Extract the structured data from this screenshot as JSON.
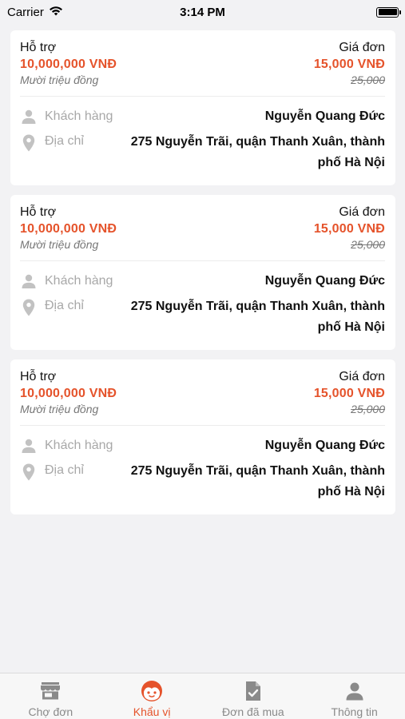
{
  "status_bar": {
    "carrier": "Carrier",
    "time": "3:14 PM"
  },
  "orders": [
    {
      "support_label": "Hỗ trợ",
      "support_amount": "10,000,000 VNĐ",
      "support_words": "Mười triệu đồng",
      "price_label": "Giá đơn",
      "price_amount": "15,000 VNĐ",
      "price_old": "25,000",
      "customer_label": "Khách hàng",
      "customer_name": "Nguyễn Quang Đức",
      "address_label": "Địa chỉ",
      "address_value": "275 Nguyễn Trãi, quận Thanh Xuân, thành phố Hà Nội"
    },
    {
      "support_label": "Hỗ trợ",
      "support_amount": "10,000,000 VNĐ",
      "support_words": "Mười triệu đồng",
      "price_label": "Giá đơn",
      "price_amount": "15,000 VNĐ",
      "price_old": "25,000",
      "customer_label": "Khách hàng",
      "customer_name": "Nguyễn Quang Đức",
      "address_label": "Địa chỉ",
      "address_value": "275 Nguyễn Trãi, quận Thanh Xuân, thành phố Hà Nội"
    },
    {
      "support_label": "Hỗ trợ",
      "support_amount": "10,000,000 VNĐ",
      "support_words": "Mười triệu đồng",
      "price_label": "Giá đơn",
      "price_amount": "15,000 VNĐ",
      "price_old": "25,000",
      "customer_label": "Khách hàng",
      "customer_name": "Nguyễn Quang Đức",
      "address_label": "Địa chỉ",
      "address_value": "275 Nguyễn Trãi, quận Thanh Xuân, thành phố Hà Nội"
    }
  ],
  "tabbar": {
    "tabs": [
      {
        "label": "Chợ đơn",
        "icon": "store-icon",
        "active": false
      },
      {
        "label": "Khẩu vị",
        "icon": "face-icon",
        "active": true
      },
      {
        "label": "Đơn đã mua",
        "icon": "purchased-doc-icon",
        "active": false
      },
      {
        "label": "Thông tin",
        "icon": "person-icon",
        "active": false
      }
    ]
  },
  "colors": {
    "accent": "#e5532b",
    "muted_text": "#777777",
    "icon_gray": "#c2c2c2",
    "tab_inactive": "#8a8a8a",
    "background": "#f2f2f4"
  }
}
